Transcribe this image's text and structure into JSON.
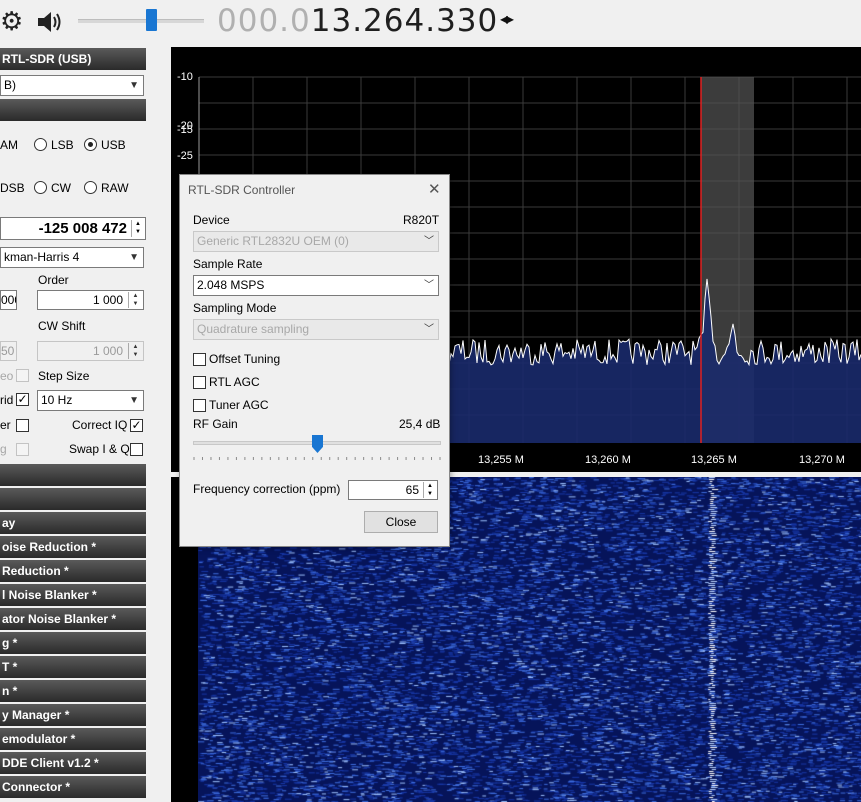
{
  "topbar": {
    "freq_dim": "000.0",
    "freq_lit": "13.264.330",
    "freq_arrows": "◂▸",
    "volume_level": 0.58
  },
  "left": {
    "source_header": "RTL-SDR (USB)",
    "source_combo": "B)",
    "radio_header": "",
    "modes_row1": [
      {
        "label": "AM",
        "selected": false
      },
      {
        "label": "LSB",
        "selected": false
      },
      {
        "label": "USB",
        "selected": true
      }
    ],
    "modes_row2": [
      {
        "label": "DSB",
        "selected": false
      },
      {
        "label": "CW",
        "selected": false
      },
      {
        "label": "RAW",
        "selected": false
      }
    ],
    "shift_value": "-125 008 472",
    "window_combo": "kman-Harris 4",
    "order_label": "Order",
    "bandwidth_value": "000",
    "order_value": "1 000",
    "cw_shift_label": "CW Shift",
    "squelch_value": "50",
    "cw_shift_value": "1 000",
    "stereo_label": "eo",
    "step_size_label": "Step Size",
    "snap_label": "rid",
    "step_value": "10 Hz",
    "filter_label": "er",
    "correct_iq_label": "Correct IQ",
    "agc_label": "g",
    "swap_iq_label": "Swap I & Q",
    "plugins": [
      "",
      "",
      "ay",
      "oise Reduction *",
      " Reduction *",
      "l Noise Blanker *",
      "ator Noise Blanker *",
      "g *",
      "T *",
      "n *",
      "y Manager *",
      "emodulator *",
      "DDE Client v1.2 *",
      "Connector *"
    ]
  },
  "spectrum": {
    "y_ticks": [
      "-10",
      "-15",
      "-20",
      "-25"
    ],
    "x_ticks": [
      "13,255 M",
      "13,260 M",
      "13,265 M",
      "13,270 M"
    ],
    "colors": {
      "background": "#000000",
      "grid": "#3a3a3a",
      "trace": "#ffffff",
      "fill": "#1a2a6b",
      "tuned_line": "#e02020",
      "filter_band": "#555555"
    }
  },
  "dialog": {
    "title": "RTL-SDR Controller",
    "close_glyph": "✕",
    "device_label": "Device",
    "device_model": "R820T",
    "device_value": "Generic RTL2832U OEM (0)",
    "sample_rate_label": "Sample Rate",
    "sample_rate_value": "2.048 MSPS",
    "sampling_mode_label": "Sampling Mode",
    "sampling_mode_value": "Quadrature sampling",
    "offset_tuning_label": "Offset Tuning",
    "rtl_agc_label": "RTL AGC",
    "tuner_agc_label": "Tuner AGC",
    "rf_gain_label": "RF Gain",
    "rf_gain_value": "25,4 dB",
    "rf_gain_level": 0.5,
    "freq_corr_label": "Frequency correction (ppm)",
    "freq_corr_value": "65",
    "close_button": "Close"
  }
}
